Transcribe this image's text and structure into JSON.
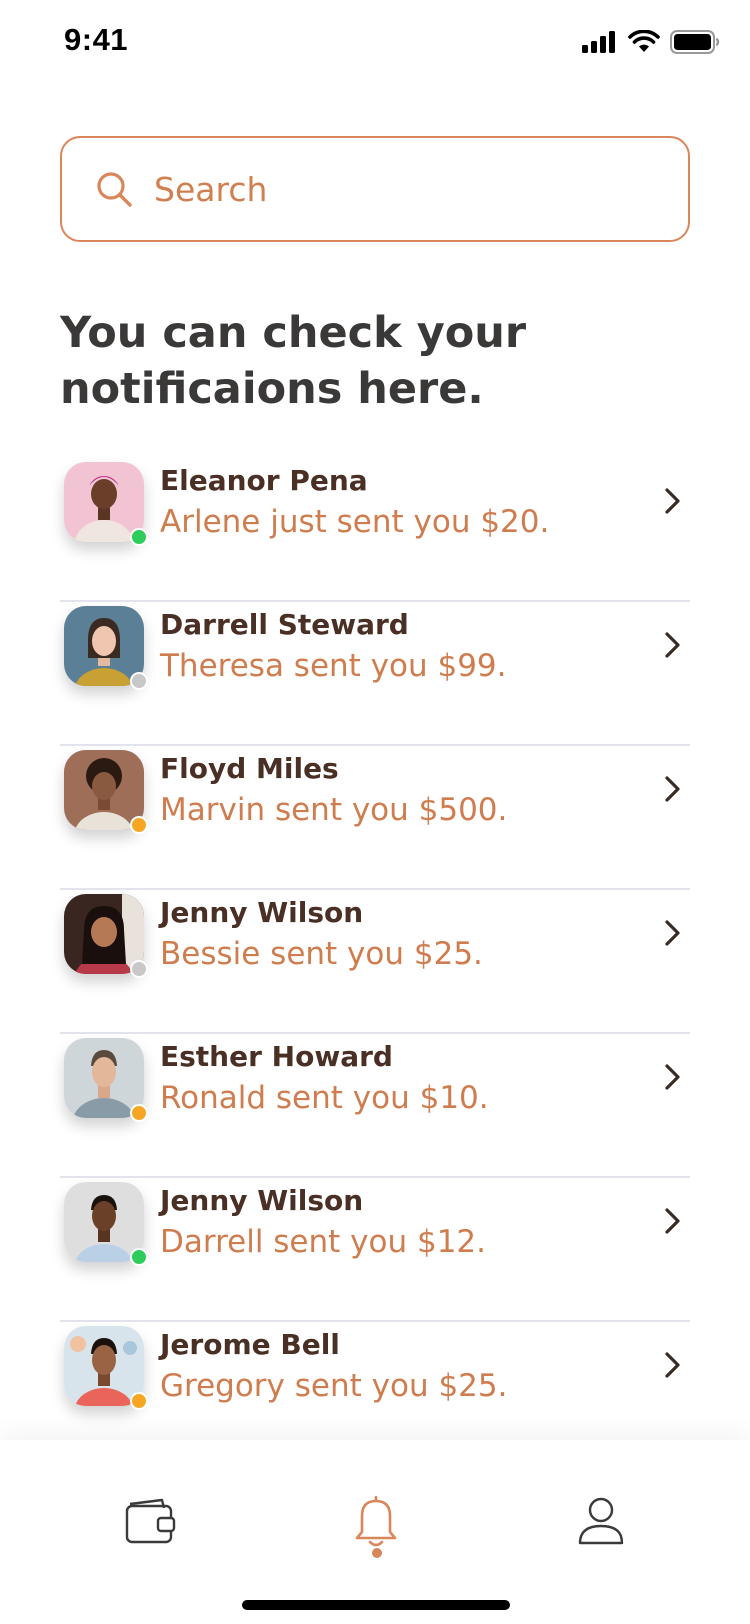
{
  "status_bar": {
    "time": "9:41",
    "icons": [
      "cellular-signal-icon",
      "wifi-icon",
      "battery-icon"
    ]
  },
  "search": {
    "placeholder": "Search",
    "value": "",
    "icon": "search-icon"
  },
  "heading": "You can check your notificaions here.",
  "notifications": [
    {
      "name": "Eleanor Pena",
      "message": "Arlene just sent you $20.",
      "status": "online"
    },
    {
      "name": "Darrell Steward",
      "message": "Theresa sent you $99.",
      "status": "offline"
    },
    {
      "name": "Floyd Miles",
      "message": "Marvin sent you $500.",
      "status": "away"
    },
    {
      "name": "Jenny Wilson",
      "message": "Bessie sent you $25.",
      "status": "offline"
    },
    {
      "name": "Esther Howard",
      "message": "Ronald sent you $10.",
      "status": "away"
    },
    {
      "name": "Jenny Wilson",
      "message": "Darrell sent you $12.",
      "status": "online"
    },
    {
      "name": "Jerome Bell",
      "message": "Gregory sent you $25.",
      "status": "away"
    }
  ],
  "tab_bar": {
    "tabs": [
      {
        "icon": "wallet-icon",
        "active": false
      },
      {
        "icon": "bell-icon",
        "active": true
      },
      {
        "icon": "user-icon",
        "active": false
      }
    ]
  },
  "colors": {
    "accent": "#d9865a",
    "message_text": "#cf7d4f",
    "name_text": "#4a2f24",
    "heading_text": "#3b3838",
    "divider": "#e3e3ee",
    "status_online": "#2ecc5a",
    "status_away": "#f6a623",
    "status_offline": "#c8c8c8"
  }
}
